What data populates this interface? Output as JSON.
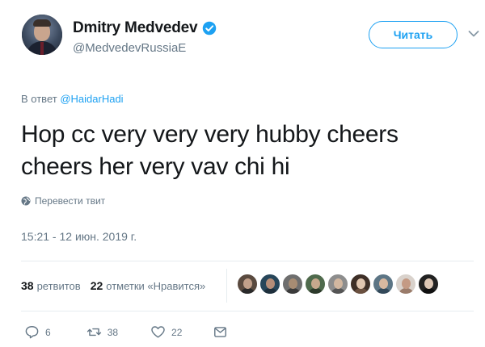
{
  "author": {
    "display_name": "Dmitry Medvedev",
    "handle": "@MedvedevRussiaE",
    "verified": true
  },
  "follow_button": {
    "label": "Читать"
  },
  "reply_to": {
    "prefix": "В ответ",
    "mention": "@HaidarHadi"
  },
  "tweet": {
    "text": "Hop cc very very very hubby cheers cheers her very vav chi hi"
  },
  "translate": {
    "label": "Перевести твит",
    "icon": "globe-icon"
  },
  "timestamp": "15:21 - 12 июн. 2019 г.",
  "stats": {
    "retweets_count": "38",
    "retweets_label": "ретвитов",
    "likes_count": "22",
    "likes_label": "отметки «Нравится»"
  },
  "liker_avatars": [
    {
      "name": "liker-1",
      "bg": "#5a4a3f",
      "face": "#c2a08a",
      "body": "#2a2a2a"
    },
    {
      "name": "liker-2",
      "bg": "#27465a",
      "face": "#b58d78",
      "body": "#1e2f3c"
    },
    {
      "name": "liker-3",
      "bg": "#6e6e6e",
      "face": "#a78c73",
      "body": "#3b3b3b"
    },
    {
      "name": "liker-4",
      "bg": "#4f6a4c",
      "face": "#c7a88d",
      "body": "#2d3a2b"
    },
    {
      "name": "liker-5",
      "bg": "#8d8d8d",
      "face": "#d2b7a0",
      "body": "#555555"
    },
    {
      "name": "liker-6",
      "bg": "#3e2f27",
      "face": "#e0c6b0",
      "body": "#6b5140"
    },
    {
      "name": "liker-7",
      "bg": "#5c7585",
      "face": "#d8b8a0",
      "body": "#33495a"
    },
    {
      "name": "liker-8",
      "bg": "#d9d2cc",
      "face": "#c49a84",
      "body": "#9a7b6a"
    },
    {
      "name": "liker-9",
      "bg": "#222222",
      "face": "#ddc7b5",
      "body": "#111111"
    }
  ],
  "actions": {
    "reply_count": "6",
    "retweet_count": "38",
    "like_count": "22"
  },
  "colors": {
    "accent": "#1da1f2",
    "secondary_text": "#657786",
    "primary_text": "#14171a"
  }
}
